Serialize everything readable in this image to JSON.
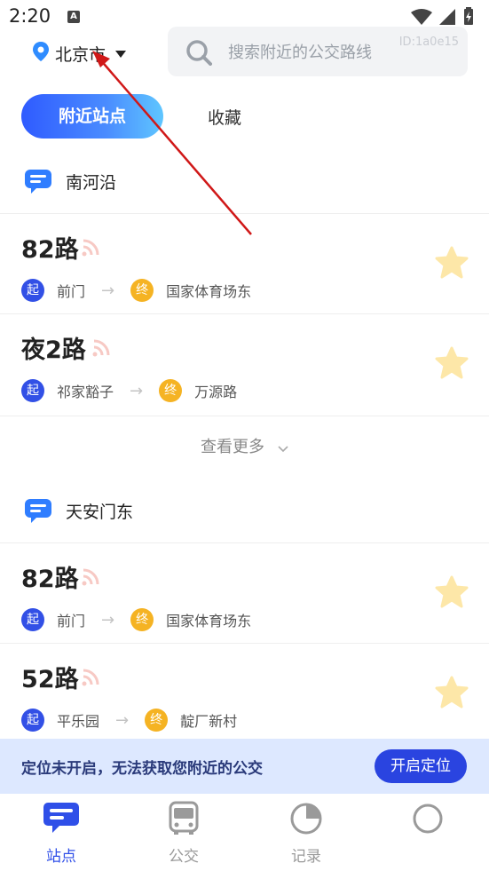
{
  "status_bar": {
    "time": "2:20",
    "notif": "A"
  },
  "header": {
    "city": "北京市",
    "search_placeholder": "搜索附近的公交路线",
    "search_id": "ID:1a0e15"
  },
  "tabs": {
    "active": "附近站点",
    "other": "收藏"
  },
  "stations": [
    {
      "name": "南河沿",
      "routes": [
        {
          "name": "82路",
          "start_badge": "起",
          "start": "前门",
          "end_badge": "终",
          "end": "国家体育场东"
        },
        {
          "name": "夜2路",
          "start_badge": "起",
          "start": "祁家豁子",
          "end_badge": "终",
          "end": "万源路"
        }
      ]
    },
    {
      "name": "天安门东",
      "routes": [
        {
          "name": "82路",
          "start_badge": "起",
          "start": "前门",
          "end_badge": "终",
          "end": "国家体育场东"
        },
        {
          "name": "52路",
          "start_badge": "起",
          "start": "平乐园",
          "end_badge": "终",
          "end": "靛厂新村"
        }
      ]
    }
  ],
  "more_label": "查看更多",
  "arrow_glyph": "→",
  "banner": {
    "text": "定位未开启，无法获取您附近的公交",
    "button": "开启定位"
  },
  "bottom_nav": [
    {
      "label": "站点",
      "icon": "station-icon",
      "active": true
    },
    {
      "label": "公交",
      "icon": "bus-icon",
      "active": false
    },
    {
      "label": "记录",
      "icon": "record-icon",
      "active": false
    },
    {
      "label": "",
      "icon": "profile-icon",
      "active": false
    }
  ],
  "colors": {
    "accent": "#2f4fe8",
    "star": "#fde7a8",
    "start_badge": "#3250e6",
    "end_badge": "#f5b323",
    "banner_bg": "#dde8ff"
  }
}
